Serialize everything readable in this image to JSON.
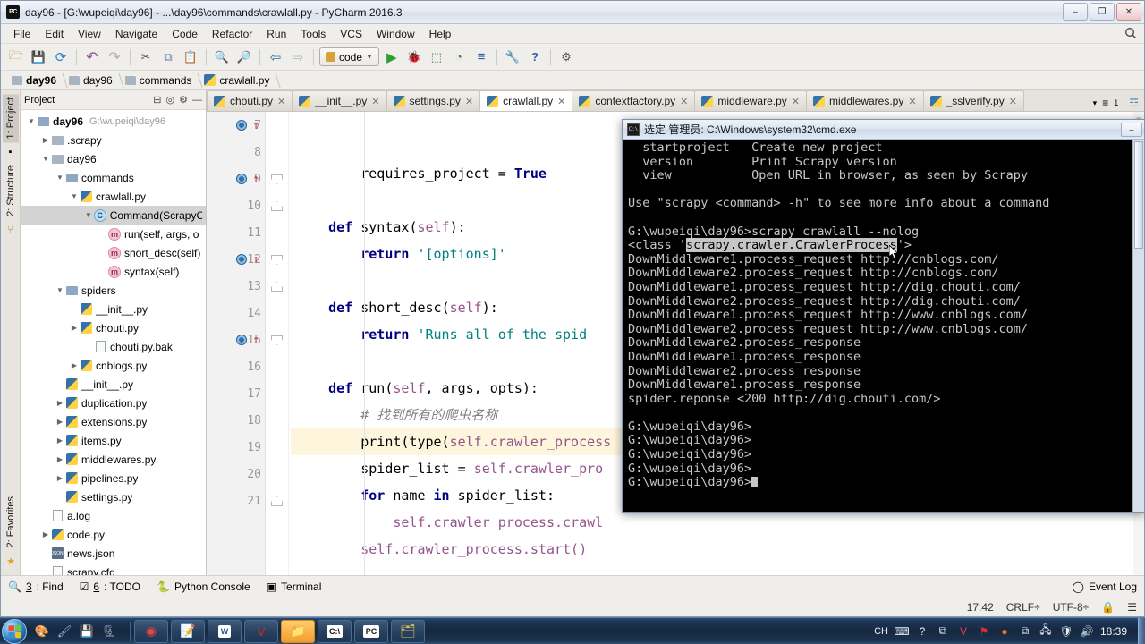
{
  "window": {
    "title": "day96 - [G:\\wupeiqi\\day96] - ...\\day96\\commands\\crawlall.py - PyCharm 2016.3",
    "logo": "PC",
    "minimize": "–",
    "maximize": "❐",
    "close": "✕"
  },
  "menu": {
    "items": [
      "File",
      "Edit",
      "View",
      "Navigate",
      "Code",
      "Refactor",
      "Run",
      "Tools",
      "VCS",
      "Window",
      "Help"
    ],
    "search_icon": "Q"
  },
  "toolbar": {
    "icons": [
      {
        "name": "open-folder-icon",
        "glyph": "🗁"
      },
      {
        "name": "save-all-icon",
        "glyph": "💾"
      },
      {
        "name": "sync-icon",
        "glyph": "⟳"
      },
      {
        "name": "undo-icon",
        "glyph": "↶"
      },
      {
        "name": "redo-icon",
        "glyph": "↷"
      },
      {
        "name": "cut-icon",
        "glyph": "✂"
      },
      {
        "name": "copy-icon",
        "glyph": "⧉"
      },
      {
        "name": "paste-icon",
        "glyph": "📋"
      },
      {
        "name": "find-icon",
        "glyph": "🔍"
      },
      {
        "name": "replace-icon",
        "glyph": "🔎"
      },
      {
        "name": "back-icon",
        "glyph": "⇦"
      },
      {
        "name": "forward-icon",
        "glyph": "⇨"
      }
    ],
    "run_config": "code",
    "run_icons": [
      {
        "name": "run-icon",
        "glyph": "▶",
        "color": "#2e9e34"
      },
      {
        "name": "debug-icon",
        "glyph": "🐞",
        "color": "#3a7d3a"
      },
      {
        "name": "coverage-icon",
        "glyph": "⬚",
        "color": "#3f7d3f"
      },
      {
        "name": "profile-icon",
        "glyph": "◔",
        "color": "#3f7d3f"
      },
      {
        "name": "attach-icon",
        "glyph": "≡",
        "color": "#2b5fa6"
      },
      {
        "name": "settings-icon",
        "glyph": "🔧",
        "color": "#777"
      },
      {
        "name": "help-icon",
        "glyph": "?",
        "color": "#2b5fa6"
      },
      {
        "name": "vcs-update-icon",
        "glyph": "⚙",
        "color": "#556"
      }
    ]
  },
  "breadcrumb": [
    {
      "label": "day96",
      "icon": "folder",
      "bold": true
    },
    {
      "label": "day96",
      "icon": "folder",
      "bold": false
    },
    {
      "label": "commands",
      "icon": "folder",
      "bold": false
    },
    {
      "label": "crawlall.py",
      "icon": "python",
      "bold": false
    }
  ],
  "left_strip": {
    "project_tab": "1: Project",
    "structure_tab": "2: Structure",
    "favorites_tab": "2: Favorites"
  },
  "project_panel": {
    "header": "Project",
    "root_label": "day96",
    "root_path": "G:\\wupeiqi\\day96",
    "tree": [
      {
        "indent": 1,
        "arrow": "▶",
        "icon": "folder",
        "label": ".scrapy",
        "selected": false
      },
      {
        "indent": 1,
        "arrow": "▼",
        "icon": "folder",
        "label": "day96",
        "selected": false
      },
      {
        "indent": 2,
        "arrow": "▼",
        "icon": "folder-blue",
        "label": "commands",
        "selected": false
      },
      {
        "indent": 3,
        "arrow": "▼",
        "icon": "python",
        "label": "crawlall.py",
        "selected": false
      },
      {
        "indent": 4,
        "arrow": "▼",
        "icon": "class",
        "label": "Command(ScrapyC",
        "selected": true
      },
      {
        "indent": 5,
        "arrow": "",
        "icon": "method",
        "label": "run(self, args, o",
        "selected": false
      },
      {
        "indent": 5,
        "arrow": "",
        "icon": "method",
        "label": "short_desc(self)",
        "selected": false
      },
      {
        "indent": 5,
        "arrow": "",
        "icon": "method",
        "label": "syntax(self)",
        "selected": false
      },
      {
        "indent": 2,
        "arrow": "▼",
        "icon": "folder-blue",
        "label": "spiders",
        "selected": false
      },
      {
        "indent": 3,
        "arrow": "",
        "icon": "python",
        "label": "__init__.py",
        "selected": false
      },
      {
        "indent": 3,
        "arrow": "▶",
        "icon": "python",
        "label": "chouti.py",
        "selected": false
      },
      {
        "indent": 4,
        "arrow": "",
        "icon": "file",
        "label": "chouti.py.bak",
        "selected": false
      },
      {
        "indent": 3,
        "arrow": "▶",
        "icon": "python",
        "label": "cnblogs.py",
        "selected": false
      },
      {
        "indent": 2,
        "arrow": "",
        "icon": "python",
        "label": "__init__.py",
        "selected": false
      },
      {
        "indent": 2,
        "arrow": "▶",
        "icon": "python",
        "label": "duplication.py",
        "selected": false
      },
      {
        "indent": 2,
        "arrow": "▶",
        "icon": "python",
        "label": "extensions.py",
        "selected": false
      },
      {
        "indent": 2,
        "arrow": "▶",
        "icon": "python",
        "label": "items.py",
        "selected": false
      },
      {
        "indent": 2,
        "arrow": "▶",
        "icon": "python",
        "label": "middlewares.py",
        "selected": false
      },
      {
        "indent": 2,
        "arrow": "▶",
        "icon": "python",
        "label": "pipelines.py",
        "selected": false
      },
      {
        "indent": 2,
        "arrow": "",
        "icon": "python",
        "label": "settings.py",
        "selected": false
      },
      {
        "indent": 1,
        "arrow": "",
        "icon": "file",
        "label": "a.log",
        "selected": false
      },
      {
        "indent": 1,
        "arrow": "▶",
        "icon": "python",
        "label": "code.py",
        "selected": false
      },
      {
        "indent": 1,
        "arrow": "",
        "icon": "json",
        "label": "news.json",
        "selected": false
      },
      {
        "indent": 1,
        "arrow": "",
        "icon": "file",
        "label": "scrapy.cfg",
        "selected": false
      }
    ]
  },
  "editor_tabs": [
    {
      "label": "chouti.py",
      "active": false,
      "close": "✕"
    },
    {
      "label": "__init__.py",
      "active": false,
      "close": "✕"
    },
    {
      "label": "settings.py",
      "active": false,
      "close": "✕"
    },
    {
      "label": "crawlall.py",
      "active": true,
      "close": "✕"
    },
    {
      "label": "contextfactory.py",
      "active": false,
      "close": "✕"
    },
    {
      "label": "middleware.py",
      "active": false,
      "close": "✕"
    },
    {
      "label": "middlewares.py",
      "active": false,
      "close": "✕"
    },
    {
      "label": "_sslverify.py",
      "active": false,
      "close": "✕"
    }
  ],
  "editor_tabs_right": {
    "overflow_caret": "▾",
    "list_icon": "≡",
    "list_count": "1",
    "db_icon": "☲"
  },
  "code": {
    "lines": [
      {
        "num": "7",
        "breakpoint": true,
        "fold": "",
        "highlight": false,
        "tokens": [
          {
            "t": "        ",
            "c": "plain"
          },
          {
            "t": "requires_project ",
            "c": "plain"
          },
          {
            "t": "= ",
            "c": "plain"
          },
          {
            "t": "True",
            "c": "kw"
          }
        ]
      },
      {
        "num": "8",
        "breakpoint": false,
        "fold": "",
        "highlight": false,
        "tokens": []
      },
      {
        "num": "9",
        "breakpoint": true,
        "fold": "start",
        "highlight": false,
        "tokens": [
          {
            "t": "    ",
            "c": "plain"
          },
          {
            "t": "def ",
            "c": "kw"
          },
          {
            "t": "syntax",
            "c": "fn"
          },
          {
            "t": "(",
            "c": "plain"
          },
          {
            "t": "self",
            "c": "slf"
          },
          {
            "t": "):",
            "c": "plain"
          }
        ]
      },
      {
        "num": "10",
        "breakpoint": false,
        "fold": "end",
        "highlight": false,
        "tokens": [
          {
            "t": "        ",
            "c": "plain"
          },
          {
            "t": "return ",
            "c": "kw"
          },
          {
            "t": "'[options]'",
            "c": "str"
          }
        ]
      },
      {
        "num": "11",
        "breakpoint": false,
        "fold": "",
        "highlight": false,
        "tokens": []
      },
      {
        "num": "12",
        "breakpoint": true,
        "fold": "start",
        "highlight": false,
        "tokens": [
          {
            "t": "    ",
            "c": "plain"
          },
          {
            "t": "def ",
            "c": "kw"
          },
          {
            "t": "short_desc",
            "c": "fn"
          },
          {
            "t": "(",
            "c": "plain"
          },
          {
            "t": "self",
            "c": "slf"
          },
          {
            "t": "):",
            "c": "plain"
          }
        ]
      },
      {
        "num": "13",
        "breakpoint": false,
        "fold": "end",
        "highlight": false,
        "tokens": [
          {
            "t": "        ",
            "c": "plain"
          },
          {
            "t": "return ",
            "c": "kw"
          },
          {
            "t": "'Runs all of the spid",
            "c": "str"
          }
        ]
      },
      {
        "num": "14",
        "breakpoint": false,
        "fold": "",
        "highlight": false,
        "tokens": []
      },
      {
        "num": "15",
        "breakpoint": true,
        "fold": "start",
        "highlight": false,
        "tokens": [
          {
            "t": "    ",
            "c": "plain"
          },
          {
            "t": "def ",
            "c": "kw"
          },
          {
            "t": "run",
            "c": "fn"
          },
          {
            "t": "(",
            "c": "plain"
          },
          {
            "t": "self",
            "c": "slf"
          },
          {
            "t": ", args, opts):",
            "c": "plain"
          }
        ]
      },
      {
        "num": "16",
        "breakpoint": false,
        "fold": "",
        "highlight": false,
        "tokens": [
          {
            "t": "        ",
            "c": "plain"
          },
          {
            "t": "# 找到所有的爬虫名称",
            "c": "cmt"
          }
        ]
      },
      {
        "num": "17",
        "breakpoint": false,
        "fold": "",
        "highlight": true,
        "tokens": [
          {
            "t": "        ",
            "c": "plain"
          },
          {
            "t": "print",
            "c": "plain"
          },
          {
            "t": "(type(",
            "c": "plain"
          },
          {
            "t": "self",
            "c": "slf"
          },
          {
            "t": ".crawler_process",
            "c": "slf"
          }
        ]
      },
      {
        "num": "18",
        "breakpoint": false,
        "fold": "",
        "highlight": false,
        "tokens": [
          {
            "t": "        ",
            "c": "plain"
          },
          {
            "t": "spider_list = ",
            "c": "plain"
          },
          {
            "t": "self",
            "c": "slf"
          },
          {
            "t": ".crawler_pro",
            "c": "slf"
          }
        ]
      },
      {
        "num": "19",
        "breakpoint": false,
        "fold": "",
        "highlight": false,
        "tokens": [
          {
            "t": "        ",
            "c": "plain"
          },
          {
            "t": "for ",
            "c": "kw"
          },
          {
            "t": "name ",
            "c": "plain"
          },
          {
            "t": "in ",
            "c": "kw"
          },
          {
            "t": "spider_list:",
            "c": "plain"
          }
        ]
      },
      {
        "num": "20",
        "breakpoint": false,
        "fold": "",
        "highlight": false,
        "tokens": [
          {
            "t": "            ",
            "c": "plain"
          },
          {
            "t": "self",
            "c": "slf"
          },
          {
            "t": ".crawler_process.crawl",
            "c": "slf"
          }
        ]
      },
      {
        "num": "21",
        "breakpoint": false,
        "fold": "end",
        "highlight": false,
        "tokens": [
          {
            "t": "        ",
            "c": "plain"
          },
          {
            "t": "self",
            "c": "slf"
          },
          {
            "t": ".crawler_process.start()",
            "c": "slf"
          }
        ]
      }
    ]
  },
  "bottom_tools": [
    {
      "icon": "find-icon",
      "glyph": "🔍",
      "num": "3",
      "label": ": Find"
    },
    {
      "icon": "todo-icon",
      "glyph": "☑",
      "num": "6",
      "label": ": TODO"
    },
    {
      "icon": "python-console-icon",
      "glyph": "🐍",
      "num": "",
      "label": "Python Console"
    },
    {
      "icon": "terminal-icon",
      "glyph": "▣",
      "num": "",
      "label": "Terminal"
    }
  ],
  "event_log": {
    "label": "Event Log",
    "icon": "◯"
  },
  "statusbar": {
    "time": "17:42",
    "line_ending": "CRLF÷",
    "encoding": "UTF-8÷",
    "lock_icon": "🔒",
    "db_icon": "☰"
  },
  "cmd": {
    "title": "选定 管理员: C:\\Windows\\system32\\cmd.exe",
    "icon": "C:\\",
    "minimize": "–",
    "maximize": "❐",
    "close": "✕",
    "lines_before_selection": [
      "  startproject   Create new project",
      "  version        Print Scrapy version",
      "  view           Open URL in browser, as seen by Scrapy",
      "",
      "Use \"scrapy <command> -h\" to see more info about a command",
      "",
      "G:\\wupeiqi\\day96>scrapy crawlall --nolog"
    ],
    "selection_line": {
      "prefix": "<class '",
      "selected": "scrapy.crawler.CrawlerProcess",
      "suffix": "'>"
    },
    "lines_after_selection": [
      "DownMiddleware1.process_request http://cnblogs.com/",
      "DownMiddleware2.process_request http://cnblogs.com/",
      "DownMiddleware1.process_request http://dig.chouti.com/",
      "DownMiddleware2.process_request http://dig.chouti.com/",
      "DownMiddleware1.process_request http://www.cnblogs.com/",
      "DownMiddleware2.process_request http://www.cnblogs.com/",
      "DownMiddleware2.process_response",
      "DownMiddleware1.process_response",
      "DownMiddleware2.process_response",
      "DownMiddleware1.process_response",
      "spider.reponse <200 http://dig.chouti.com/>",
      "",
      "G:\\wupeiqi\\day96>",
      "G:\\wupeiqi\\day96>",
      "G:\\wupeiqi\\day96>",
      "G:\\wupeiqi\\day96>"
    ],
    "prompt_line": "G:\\wupeiqi\\day96>"
  },
  "taskbar": {
    "start_label": "Start",
    "quick_launch": [
      {
        "name": "ie-icon",
        "glyph": "🎨",
        "color": "#e8b33c"
      },
      {
        "name": "paint-icon",
        "glyph": "🖌",
        "color": "#8fb8d8"
      },
      {
        "name": "save-icon",
        "glyph": "💾",
        "color": "#4a78b8"
      },
      {
        "name": "tool-icon",
        "glyph": "🗜",
        "color": "#5a6a7a"
      }
    ],
    "tasks": [
      {
        "name": "chrome-taskbtn",
        "glyph": "◉",
        "active": false,
        "color": "#e8453c"
      },
      {
        "name": "notepadpp-taskbtn",
        "glyph": "📝",
        "active": false,
        "color": "#6ab04c"
      },
      {
        "name": "word-taskbtn",
        "glyph": "W",
        "active": false,
        "color": "#2b579a"
      },
      {
        "name": "youdao-taskbtn",
        "glyph": "V",
        "active": false,
        "color": "#cc2a2a"
      },
      {
        "name": "explorer-taskbtn",
        "glyph": "📁",
        "active": true,
        "color": "#f0a030"
      },
      {
        "name": "cmd-taskbtn",
        "glyph": "C:\\",
        "active": false,
        "color": "#111111"
      },
      {
        "name": "pycharm-taskbtn",
        "glyph": "PC",
        "active": false,
        "color": "#1a1a1a"
      },
      {
        "name": "folder-taskbtn",
        "glyph": "🗂",
        "active": false,
        "color": "#e0c060"
      }
    ],
    "tray": [
      {
        "name": "ime-indicator",
        "glyph": "CH"
      },
      {
        "name": "keyboard-icon",
        "glyph": "⌨"
      },
      {
        "name": "help-circle-icon",
        "glyph": "?"
      },
      {
        "name": "tray-expand-icon",
        "glyph": "⧉"
      },
      {
        "name": "youdao-tray-icon",
        "glyph": "V"
      },
      {
        "name": "flag-tray-icon",
        "glyph": "⚑"
      },
      {
        "name": "orange-dot-icon",
        "glyph": "●"
      },
      {
        "name": "window-tray-icon",
        "glyph": "⧉"
      },
      {
        "name": "network-icon",
        "glyph": "🖧"
      },
      {
        "name": "security-icon",
        "glyph": "🛡"
      },
      {
        "name": "volume-icon",
        "glyph": "🔊"
      }
    ],
    "clock": "18:39"
  }
}
